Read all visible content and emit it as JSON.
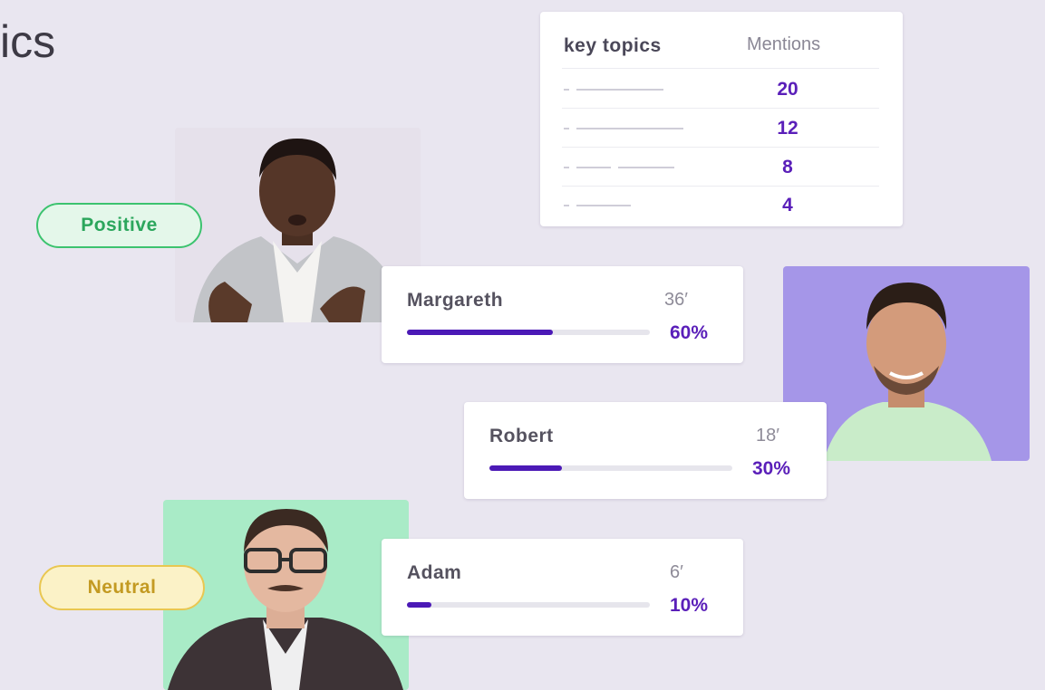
{
  "heading": "ics",
  "topics_table": {
    "header_topic": "key topics",
    "header_mentions": "Mentions",
    "rows": [
      {
        "mentions": "20"
      },
      {
        "mentions": "12"
      },
      {
        "mentions": "8"
      },
      {
        "mentions": "4"
      }
    ]
  },
  "sentiment_badges": {
    "positive": "Positive",
    "neutral": "Neutral"
  },
  "speakers": [
    {
      "name": "Margareth",
      "minutes": "36′",
      "percent": "60%",
      "share": 0.6
    },
    {
      "name": "Robert",
      "minutes": "18′",
      "percent": "30%",
      "share": 0.3
    },
    {
      "name": "Adam",
      "minutes": "6′",
      "percent": "10%",
      "share": 0.1
    }
  ],
  "colors": {
    "accent": "#5a1fb9",
    "bar_fill": "#4b19b6",
    "positive": "#2ba65c",
    "neutral": "#c39a22",
    "background": "#e9e6f0"
  }
}
